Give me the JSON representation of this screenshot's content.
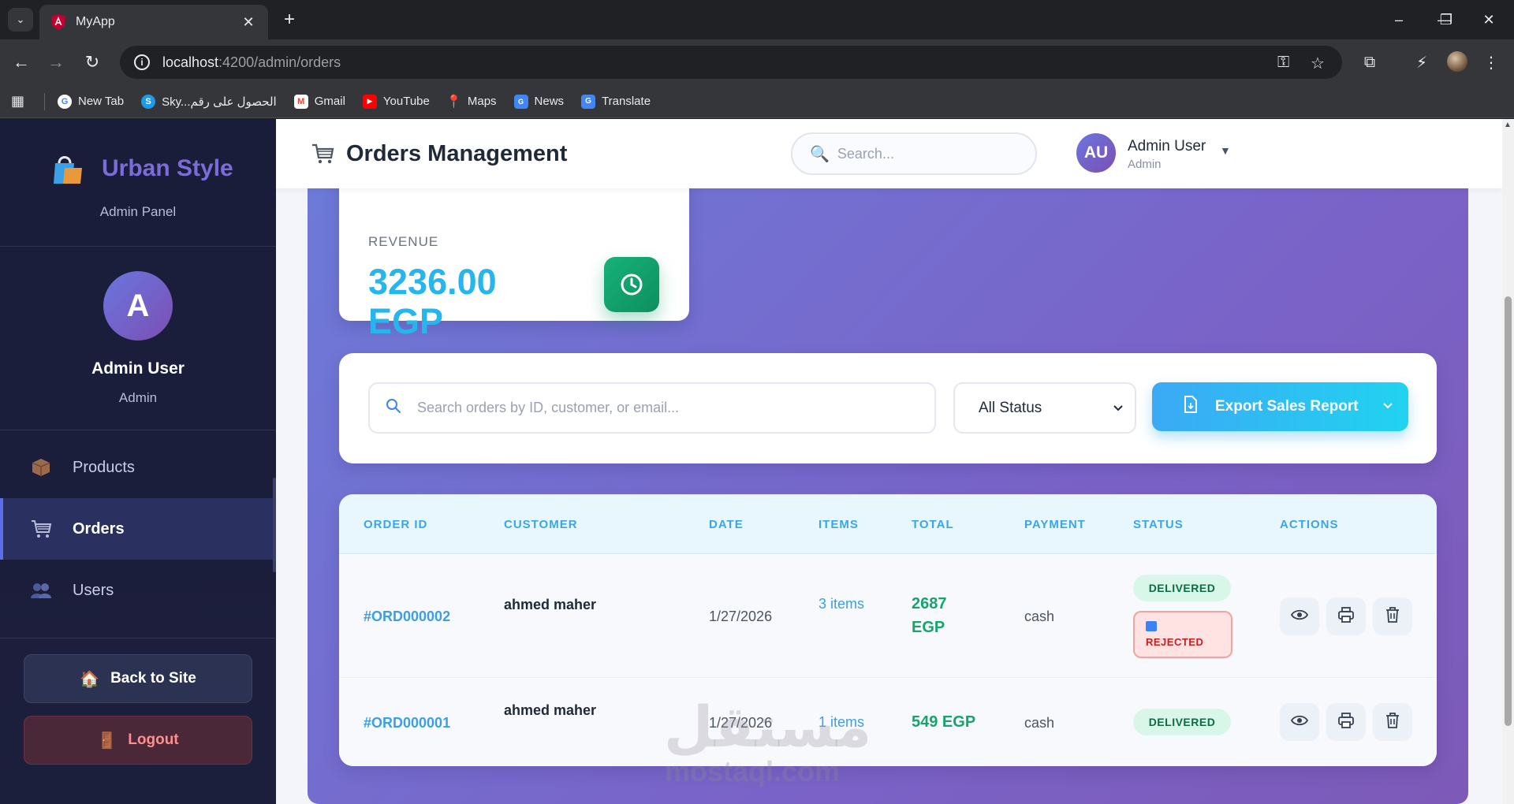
{
  "browser": {
    "tab_title": "MyApp",
    "url_host": "localhost",
    "url_path": ":4200/admin/orders",
    "bookmarks": [
      {
        "label": "New Tab",
        "icon": "google-icon",
        "color": "#4285f4"
      },
      {
        "label": "Sky...الحصول على رقم",
        "icon": "skype-icon",
        "color": "#1e9be8"
      },
      {
        "label": "Gmail",
        "icon": "gmail-icon",
        "color": "#ea4335"
      },
      {
        "label": "YouTube",
        "icon": "youtube-icon",
        "color": "#ff0000"
      },
      {
        "label": "Maps",
        "icon": "maps-icon",
        "color": "#34a853"
      },
      {
        "label": "News",
        "icon": "news-icon",
        "color": "#4285f4"
      },
      {
        "label": "Translate",
        "icon": "translate-icon",
        "color": "#4285f4"
      }
    ]
  },
  "sidebar": {
    "brand_name": "Urban Style",
    "brand_sub": "Admin Panel",
    "avatar_letter": "A",
    "user_name": "Admin User",
    "user_role": "Admin",
    "nav": [
      {
        "label": "Products",
        "icon": "box-icon",
        "active": false
      },
      {
        "label": "Orders",
        "icon": "cart-icon",
        "active": true
      },
      {
        "label": "Users",
        "icon": "users-icon",
        "active": false
      }
    ],
    "back_label": "Back to Site",
    "logout_label": "Logout"
  },
  "header": {
    "title": "Orders Management",
    "search_placeholder": "Search...",
    "avatar_initials": "AU",
    "user_name": "Admin User",
    "user_role": "Admin"
  },
  "revenue": {
    "label": "REVENUE",
    "value": "3236.00 EGP"
  },
  "filters": {
    "search_placeholder": "Search orders by ID, customer, or email...",
    "status_selected": "All Status",
    "export_label": "Export Sales Report"
  },
  "table": {
    "headers": [
      "ORDER ID",
      "CUSTOMER",
      "DATE",
      "ITEMS",
      "TOTAL",
      "PAYMENT",
      "STATUS",
      "ACTIONS"
    ],
    "rows": [
      {
        "id": "#ORD000002",
        "customer": "ahmed maher",
        "date": "1/27/2026",
        "items": "3 items",
        "total": "2687 EGP",
        "payment": "cash",
        "status": "DELIVERED",
        "sub_status": "REJECTED"
      },
      {
        "id": "#ORD000001",
        "customer": "ahmed maher",
        "date": "1/27/2026",
        "items": "1 items",
        "total": "549 EGP",
        "payment": "cash",
        "status": "DELIVERED"
      }
    ]
  },
  "watermark": {
    "arabic": "مستقل",
    "latin": "mostaql.com"
  },
  "colors": {
    "accent_blue": "#3b9fe2",
    "success_green": "#16a36c",
    "danger_red": "#c81e1e",
    "sidebar_bg": "#1a1d3a",
    "brand_purple": "#7b6cd8"
  }
}
